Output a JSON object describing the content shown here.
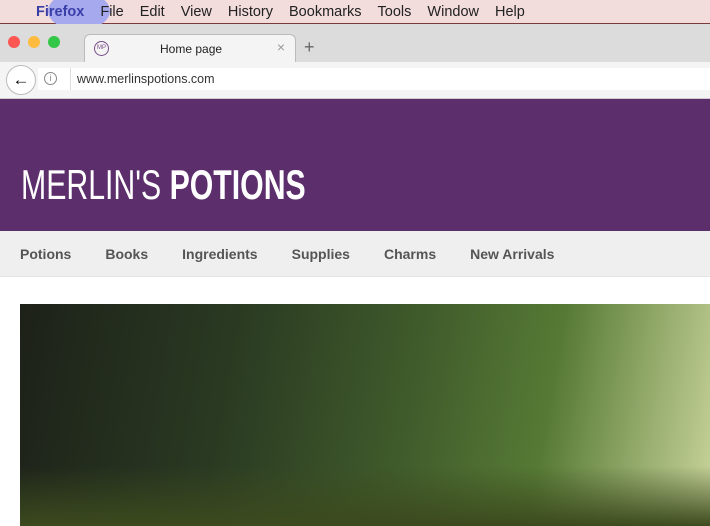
{
  "menubar": {
    "apple": "",
    "items": [
      "Firefox",
      "File",
      "Edit",
      "View",
      "History",
      "Bookmarks",
      "Tools",
      "Window",
      "Help"
    ]
  },
  "tab": {
    "favicon": "MP",
    "title": "Home page",
    "close": "×",
    "new_tab": "+"
  },
  "navbar": {
    "back": "←",
    "info": "i",
    "url": "www.merlinspotions.com"
  },
  "site": {
    "logo_light": "MERLIN'S",
    "logo_bold": "POTIONS",
    "nav": [
      "Potions",
      "Books",
      "Ingredients",
      "Supplies",
      "Charms",
      "New Arrivals"
    ]
  },
  "colors": {
    "brand": "#5c2e6b"
  }
}
